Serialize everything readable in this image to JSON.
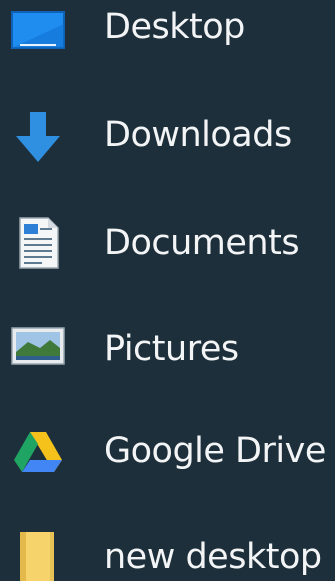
{
  "nav": {
    "items": [
      {
        "label": "Desktop",
        "icon": "desktop-icon"
      },
      {
        "label": "Downloads",
        "icon": "download-arrow-icon"
      },
      {
        "label": "Documents",
        "icon": "document-icon"
      },
      {
        "label": "Pictures",
        "icon": "pictures-icon"
      },
      {
        "label": "Google Drive",
        "icon": "google-drive-icon"
      },
      {
        "label": "new desktop",
        "icon": "folder-icon"
      }
    ]
  },
  "colors": {
    "background": "#1d2f3a",
    "text": "#f2f4f5",
    "desktop_blue": "#1e88e5",
    "download_blue": "#2f8fe0",
    "folder_yellow": "#f6d36b"
  }
}
